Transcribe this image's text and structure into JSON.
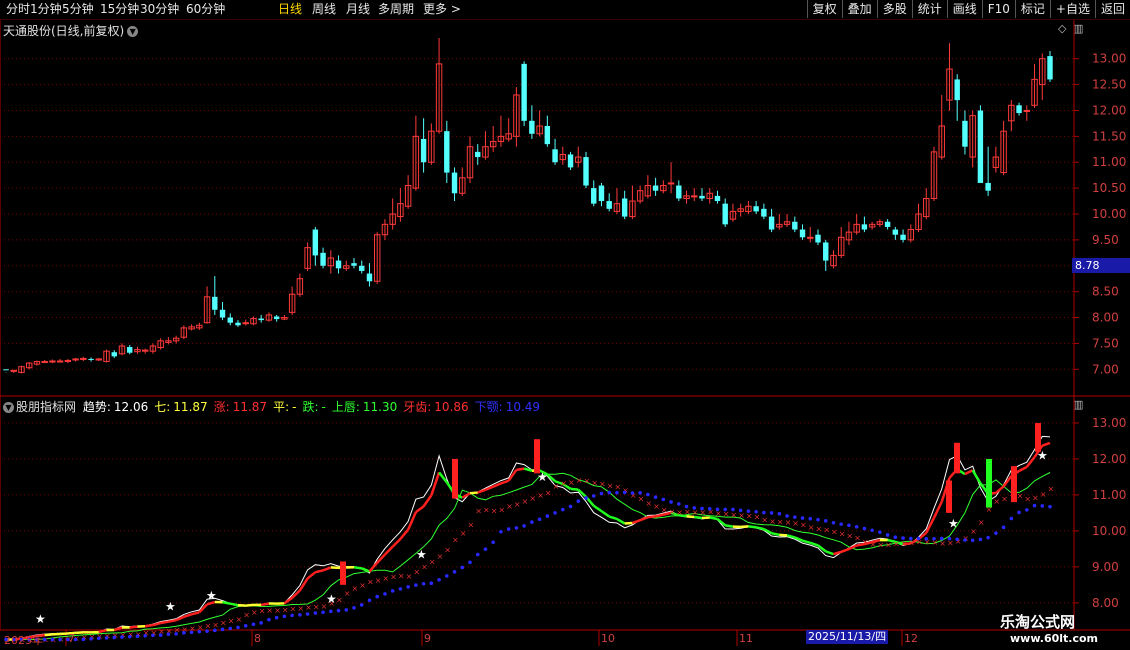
{
  "toolbar": {
    "tabs": [
      {
        "label": "分时",
        "active": false
      },
      {
        "label": "1分钟",
        "active": false
      },
      {
        "label": "5分钟",
        "active": false
      },
      {
        "label": "15分钟",
        "active": false
      },
      {
        "label": "30分钟",
        "active": false
      },
      {
        "label": "60分钟",
        "active": false
      },
      {
        "label": "日线",
        "active": true
      },
      {
        "label": "周线",
        "active": false
      },
      {
        "label": "月线",
        "active": false
      },
      {
        "label": "多周期",
        "active": false
      },
      {
        "label": "更多 >",
        "active": false
      }
    ],
    "buttons": [
      "复权",
      "叠加",
      "多股",
      "统计",
      "画线",
      "F10",
      "标记",
      "+自选",
      "返回"
    ]
  },
  "stock": {
    "title": "天通股份(日线,前复权)"
  },
  "price_axis": {
    "ticks": [
      "13.00",
      "12.50",
      "12.00",
      "11.50",
      "11.00",
      "10.50",
      "10.00",
      "9.50",
      "9.00",
      "8.50",
      "8.00",
      "7.50",
      "7.00"
    ],
    "cursor_price": "8.78"
  },
  "indicator": {
    "name": "股朋指标网",
    "items": [
      {
        "label": "趋势:",
        "value": "12.06",
        "color": "#ffffff"
      },
      {
        "label": "七:",
        "value": "11.87",
        "color": "#ffff40"
      },
      {
        "label": "涨:",
        "value": "11.87",
        "color": "#ff3030"
      },
      {
        "label": "平:",
        "value": "-",
        "color": "#ffff40"
      },
      {
        "label": "跌:",
        "value": "-",
        "color": "#30ff30"
      },
      {
        "label": "上唇:",
        "value": "11.30",
        "color": "#30ff30"
      },
      {
        "label": "牙齿:",
        "value": "10.86",
        "color": "#ff3030"
      },
      {
        "label": "下颚:",
        "value": "10.49",
        "color": "#3030ff"
      }
    ],
    "ticks": [
      "13.00",
      "12.00",
      "11.00",
      "10.00",
      "9.00",
      "8.00"
    ]
  },
  "date_axis": {
    "labels": [
      "2025年",
      "7",
      "8",
      "9",
      "10",
      "11",
      "12"
    ],
    "cursor_date": "2025/11/13/四"
  },
  "watermark": {
    "line1": "乐淘公式网",
    "line2": "www.60lt.com"
  },
  "colors": {
    "up": "#ff3a3a",
    "down": "#54ffff",
    "grid": "#7a0000",
    "axis": "#b00000"
  },
  "chart_data": {
    "type": "candlestick",
    "ylim": [
      6.6,
      13.4
    ],
    "candles": [
      [
        7.0,
        6.98,
        6.95,
        6.94
      ],
      [
        6.96,
        6.98,
        6.96,
        6.93
      ],
      [
        6.94,
        7.05,
        7.07,
        6.92
      ],
      [
        7.03,
        7.12,
        7.14,
        7.0
      ],
      [
        7.1,
        7.15,
        7.17,
        7.07
      ],
      [
        7.14,
        7.15,
        7.18,
        7.12
      ],
      [
        7.15,
        7.16,
        7.19,
        7.12
      ],
      [
        7.16,
        7.16,
        7.2,
        7.13
      ],
      [
        7.15,
        7.17,
        7.2,
        7.12
      ],
      [
        7.18,
        7.2,
        7.22,
        7.15
      ],
      [
        7.19,
        7.21,
        7.24,
        7.16
      ],
      [
        7.2,
        7.18,
        7.23,
        7.15
      ],
      [
        7.18,
        7.2,
        7.22,
        7.16
      ],
      [
        7.15,
        7.35,
        7.38,
        7.13
      ],
      [
        7.33,
        7.25,
        7.37,
        7.22
      ],
      [
        7.3,
        7.45,
        7.5,
        7.27
      ],
      [
        7.43,
        7.32,
        7.47,
        7.29
      ],
      [
        7.34,
        7.38,
        7.44,
        7.3
      ],
      [
        7.35,
        7.37,
        7.4,
        7.3
      ],
      [
        7.35,
        7.45,
        7.5,
        7.3
      ],
      [
        7.42,
        7.55,
        7.6,
        7.38
      ],
      [
        7.52,
        7.55,
        7.62,
        7.48
      ],
      [
        7.55,
        7.6,
        7.65,
        7.5
      ],
      [
        7.62,
        7.8,
        7.85,
        7.58
      ],
      [
        7.78,
        7.82,
        7.87,
        7.75
      ],
      [
        7.8,
        7.85,
        7.9,
        7.76
      ],
      [
        7.9,
        8.4,
        8.6,
        7.88
      ],
      [
        8.4,
        8.15,
        8.8,
        8.05
      ],
      [
        8.15,
        8.0,
        8.3,
        7.95
      ],
      [
        8.0,
        7.9,
        8.08,
        7.85
      ],
      [
        7.9,
        7.85,
        7.95,
        7.82
      ],
      [
        7.88,
        7.9,
        7.96,
        7.85
      ],
      [
        7.88,
        7.98,
        8.02,
        7.85
      ],
      [
        7.98,
        7.95,
        8.05,
        7.9
      ],
      [
        7.95,
        8.05,
        8.1,
        7.92
      ],
      [
        8.02,
        7.97,
        8.05,
        7.92
      ],
      [
        7.97,
        8.0,
        8.05,
        7.95
      ],
      [
        8.1,
        8.45,
        8.6,
        8.05
      ],
      [
        8.45,
        8.75,
        8.85,
        8.4
      ],
      [
        8.95,
        9.35,
        9.45,
        8.9
      ],
      [
        9.7,
        9.2,
        9.75,
        9.0
      ],
      [
        9.25,
        9.0,
        9.35,
        8.95
      ],
      [
        9.0,
        9.15,
        9.3,
        8.85
      ],
      [
        9.1,
        8.95,
        9.2,
        8.85
      ],
      [
        8.95,
        9.0,
        9.1,
        8.9
      ],
      [
        9.05,
        9.0,
        9.15,
        8.95
      ],
      [
        9.0,
        8.9,
        9.1,
        8.85
      ],
      [
        8.85,
        8.7,
        9.05,
        8.6
      ],
      [
        8.7,
        9.6,
        9.65,
        8.65
      ],
      [
        9.6,
        9.8,
        9.9,
        9.5
      ],
      [
        9.8,
        10.0,
        10.3,
        9.7
      ],
      [
        9.95,
        10.2,
        10.5,
        9.85
      ],
      [
        10.15,
        10.55,
        10.75,
        10.1
      ],
      [
        10.5,
        11.5,
        11.9,
        10.45
      ],
      [
        11.45,
        11.0,
        11.85,
        10.8
      ],
      [
        11.0,
        11.6,
        11.75,
        10.95
      ],
      [
        11.6,
        12.9,
        13.4,
        11.55
      ],
      [
        11.6,
        10.8,
        11.8,
        10.6
      ],
      [
        10.8,
        10.4,
        10.9,
        10.25
      ],
      [
        10.4,
        10.7,
        10.9,
        10.35
      ],
      [
        10.7,
        11.3,
        11.5,
        10.6
      ],
      [
        11.2,
        11.1,
        11.35,
        10.95
      ],
      [
        11.1,
        11.3,
        11.6,
        11.05
      ],
      [
        11.3,
        11.4,
        11.7,
        11.2
      ],
      [
        11.4,
        11.5,
        11.9,
        11.3
      ],
      [
        11.45,
        11.55,
        11.85,
        11.4
      ],
      [
        11.5,
        12.3,
        12.45,
        11.3
      ],
      [
        12.9,
        11.8,
        12.95,
        11.7
      ],
      [
        11.8,
        11.55,
        12.1,
        11.45
      ],
      [
        11.55,
        11.7,
        12.0,
        11.5
      ],
      [
        11.7,
        11.35,
        11.9,
        11.3
      ],
      [
        11.25,
        11.0,
        11.45,
        10.95
      ],
      [
        11.05,
        11.15,
        11.3,
        10.95
      ],
      [
        11.15,
        10.9,
        11.2,
        10.85
      ],
      [
        11.0,
        11.1,
        11.3,
        10.9
      ],
      [
        11.1,
        10.55,
        11.2,
        10.5
      ],
      [
        10.5,
        10.2,
        10.65,
        10.15
      ],
      [
        10.55,
        10.25,
        10.6,
        10.15
      ],
      [
        10.25,
        10.1,
        10.4,
        10.05
      ],
      [
        10.05,
        10.2,
        10.5,
        10.0
      ],
      [
        10.3,
        9.95,
        10.45,
        9.9
      ],
      [
        9.95,
        10.25,
        10.55,
        9.9
      ],
      [
        10.25,
        10.45,
        10.55,
        10.2
      ],
      [
        10.35,
        10.55,
        10.75,
        10.3
      ],
      [
        10.55,
        10.45,
        10.7,
        10.35
      ],
      [
        10.45,
        10.55,
        10.65,
        10.4
      ],
      [
        10.6,
        10.6,
        11.0,
        10.4
      ],
      [
        10.55,
        10.3,
        10.65,
        10.25
      ],
      [
        10.3,
        10.35,
        10.45,
        10.2
      ],
      [
        10.35,
        10.35,
        10.5,
        10.25
      ],
      [
        10.35,
        10.3,
        10.5,
        10.25
      ],
      [
        10.3,
        10.4,
        10.5,
        10.2
      ],
      [
        10.35,
        10.25,
        10.45,
        10.2
      ],
      [
        10.2,
        9.8,
        10.3,
        9.75
      ],
      [
        9.9,
        10.05,
        10.2,
        9.85
      ],
      [
        10.05,
        10.1,
        10.2,
        9.95
      ],
      [
        10.05,
        10.15,
        10.25,
        10.0
      ],
      [
        10.15,
        10.05,
        10.25,
        10.0
      ],
      [
        10.1,
        9.95,
        10.2,
        9.9
      ],
      [
        9.95,
        9.7,
        10.1,
        9.65
      ],
      [
        9.75,
        9.8,
        10.0,
        9.7
      ],
      [
        9.8,
        9.85,
        10.0,
        9.75
      ],
      [
        9.85,
        9.7,
        9.95,
        9.65
      ],
      [
        9.7,
        9.55,
        9.8,
        9.5
      ],
      [
        9.55,
        9.55,
        9.75,
        9.45
      ],
      [
        9.6,
        9.45,
        9.7,
        9.4
      ],
      [
        9.45,
        9.1,
        9.5,
        8.9
      ],
      [
        9.0,
        9.2,
        9.3,
        8.95
      ],
      [
        9.2,
        9.55,
        9.75,
        9.15
      ],
      [
        9.5,
        9.65,
        9.85,
        9.4
      ],
      [
        9.65,
        9.8,
        10.0,
        9.6
      ],
      [
        9.8,
        9.7,
        9.95,
        9.65
      ],
      [
        9.75,
        9.8,
        9.85,
        9.7
      ],
      [
        9.8,
        9.85,
        9.9,
        9.75
      ],
      [
        9.85,
        9.75,
        9.9,
        9.7
      ],
      [
        9.7,
        9.6,
        9.75,
        9.5
      ],
      [
        9.6,
        9.5,
        9.7,
        9.45
      ],
      [
        9.5,
        9.7,
        9.8,
        9.45
      ],
      [
        9.7,
        10.0,
        10.2,
        9.65
      ],
      [
        9.95,
        10.3,
        10.5,
        9.9
      ],
      [
        10.3,
        11.2,
        11.3,
        10.25
      ],
      [
        11.1,
        11.7,
        12.3,
        11.05
      ],
      [
        12.2,
        12.8,
        13.3,
        12.0
      ],
      [
        12.6,
        12.2,
        12.7,
        11.8
      ],
      [
        11.8,
        11.3,
        12.0,
        11.15
      ],
      [
        11.1,
        11.9,
        12.0,
        10.9
      ],
      [
        12.0,
        10.6,
        12.1,
        10.6
      ],
      [
        10.6,
        10.45,
        11.3,
        10.35
      ],
      [
        10.9,
        11.1,
        11.3,
        10.8
      ],
      [
        10.8,
        11.6,
        11.8,
        10.75
      ],
      [
        11.8,
        12.1,
        12.2,
        11.6
      ],
      [
        12.1,
        11.95,
        12.15,
        11.9
      ],
      [
        12.0,
        12.0,
        12.1,
        11.8
      ],
      [
        12.1,
        12.6,
        12.9,
        12.05
      ],
      [
        12.5,
        13.0,
        13.1,
        12.2
      ],
      [
        13.05,
        12.6,
        13.15,
        12.55
      ]
    ]
  }
}
